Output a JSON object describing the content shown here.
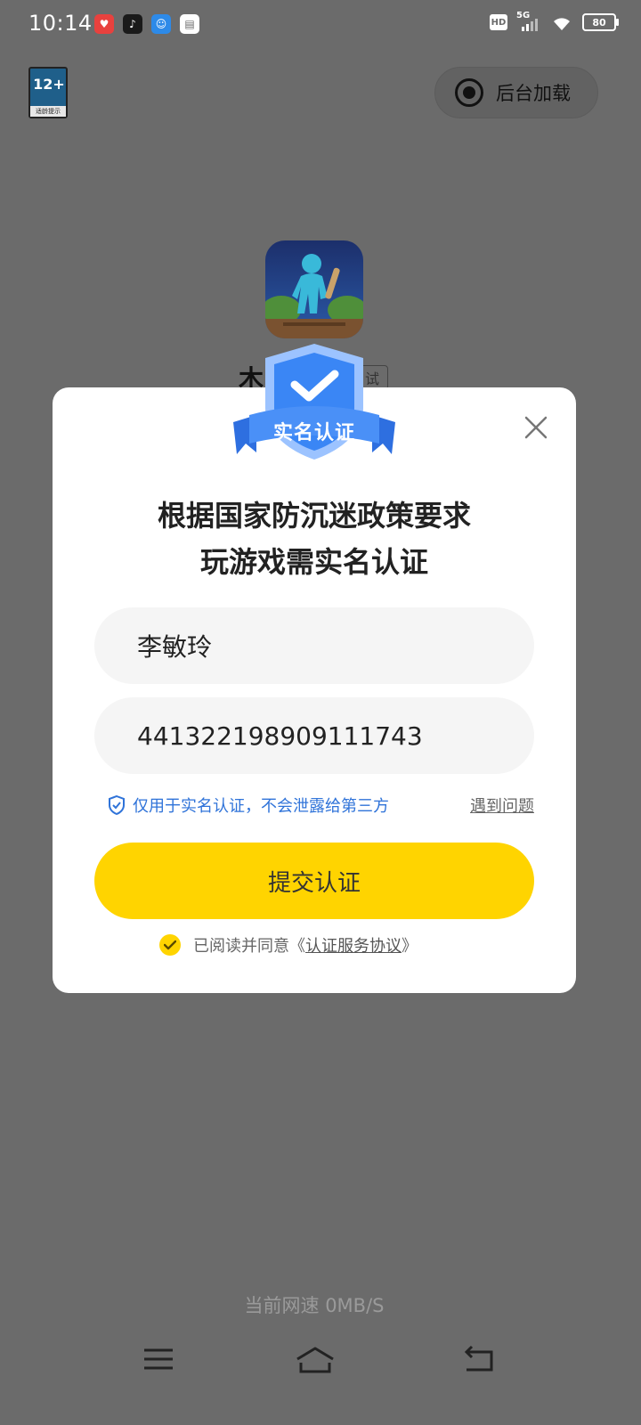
{
  "status_bar": {
    "time": "10:14",
    "hd": "HD",
    "network": "5G",
    "battery": "80",
    "app_icons": [
      "notification-app-icon-1",
      "tiktok-icon",
      "notification-app-icon-3",
      "calendar-icon"
    ]
  },
  "age_rating": {
    "age": "12+",
    "label": "适龄提示"
  },
  "background_load": {
    "label": "后台加载"
  },
  "game": {
    "title_peek": "木",
    "tag_peek": "试"
  },
  "dialog": {
    "emblem_label": "实名认证",
    "heading_line1": "根据国家防沉迷政策要求",
    "heading_line2": "玩游戏需实名认证",
    "name_value": "李敏玲",
    "id_value": "441322198909111743",
    "privacy_note": "仅用于实名认证，不会泄露给第三方",
    "help_link": "遇到问题",
    "submit_label": "提交认证",
    "agree_prefix": "已阅读并同意《",
    "agreement_link": "认证服务协议",
    "agree_suffix": "》"
  },
  "footer": {
    "net_speed": "当前网速 0MB/S"
  },
  "colors": {
    "overlay": "#6b6b6b",
    "accent_yellow": "#ffd400",
    "link_blue": "#2f73d9",
    "emblem_blue": "#3a86f5"
  }
}
